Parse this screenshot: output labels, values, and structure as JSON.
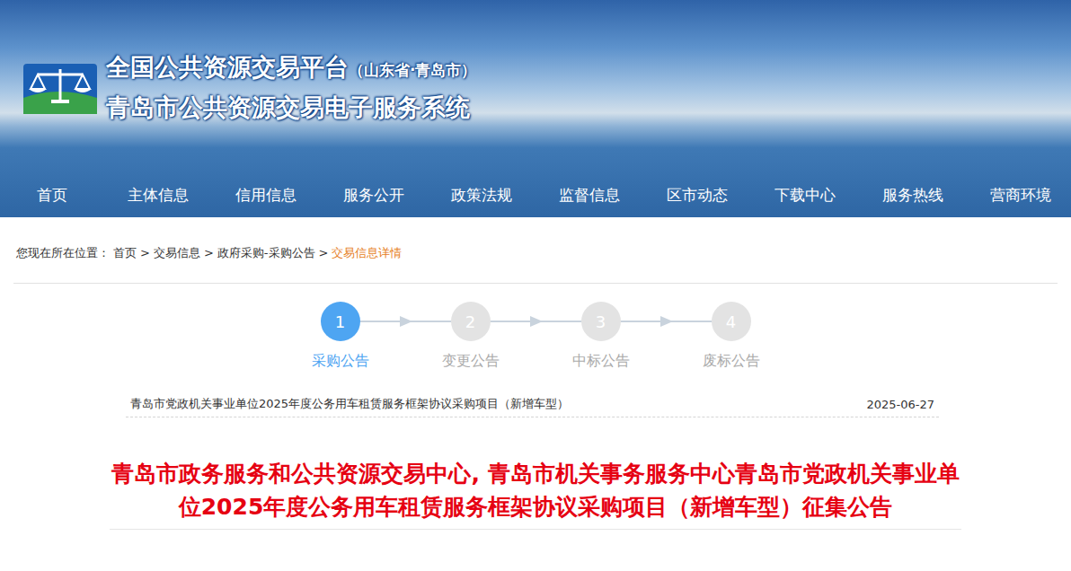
{
  "header": {
    "platform_title": "全国公共资源交易平台",
    "platform_region": "（山东省·青岛市）",
    "system_title": "青岛市公共资源交易电子服务系统"
  },
  "nav": [
    {
      "label": "首页"
    },
    {
      "label": "主体信息"
    },
    {
      "label": "信用信息"
    },
    {
      "label": "服务公开"
    },
    {
      "label": "政策法规"
    },
    {
      "label": "监督信息"
    },
    {
      "label": "区市动态"
    },
    {
      "label": "下载中心"
    },
    {
      "label": "服务热线"
    },
    {
      "label": "营商环境"
    }
  ],
  "breadcrumb": {
    "prefix": "您现在所在位置：",
    "separator": ">",
    "items": [
      {
        "label": "首页",
        "current": false
      },
      {
        "label": "交易信息",
        "current": false
      },
      {
        "label": "政府采购-采购公告",
        "current": false
      },
      {
        "label": "交易信息详情",
        "current": true
      }
    ]
  },
  "steps": [
    {
      "number": "1",
      "label": "采购公告",
      "selected": true
    },
    {
      "number": "2",
      "label": "变更公告",
      "selected": false
    },
    {
      "number": "3",
      "label": "中标公告",
      "selected": false
    },
    {
      "number": "4",
      "label": "废标公告",
      "selected": false
    }
  ],
  "notice": {
    "title": "青岛市党政机关事业单位2025年度公务用车租赁服务框架协议采购项目（新增车型）",
    "date": "2025-06-27"
  },
  "heading": "青岛市政务服务和公共资源交易中心, 青岛市机关事务服务中心青岛市党政机关事业单位2025年度公务用车租赁服务框架协议采购项目（新增车型）征集公告"
}
